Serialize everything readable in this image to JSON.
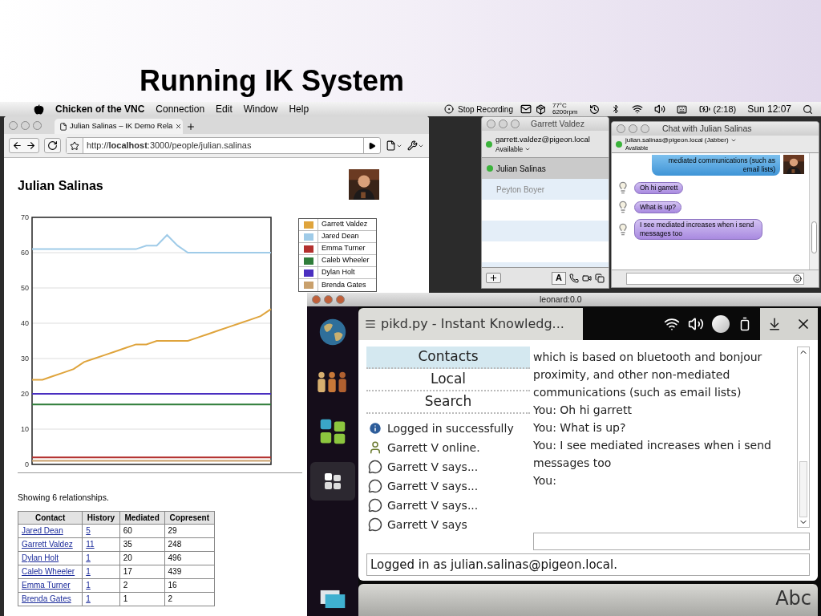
{
  "slide": {
    "title": "Running IK System"
  },
  "menubar": {
    "app": "Chicken of the VNC",
    "menus": [
      "Connection",
      "Edit",
      "Window",
      "Help"
    ],
    "recording": "Stop Recording",
    "temperature": "77°C",
    "fan": "6200rpm",
    "battery": "(2:18)",
    "clock": "Sun 12:07"
  },
  "browser": {
    "tab": {
      "title": "Julian Salinas – IK Demo Rela",
      "selected": true
    },
    "url": "http://**localhost**:3000/people/julian.salinas",
    "page": {
      "heading": "Julian Salinas",
      "chart_data": {
        "type": "line",
        "grid": true,
        "ylim": [
          0,
          70
        ],
        "yticks": [
          0,
          10,
          20,
          30,
          40,
          50,
          60,
          70
        ],
        "series": [
          {
            "name": "Garrett Valdez",
            "color": "#dfa43c",
            "values": [
              24,
              24,
              25,
              26,
              27,
              29,
              30,
              31,
              32,
              33,
              34,
              34,
              35,
              35,
              35,
              35,
              36,
              37,
              38,
              39,
              40,
              41,
              42,
              44
            ]
          },
          {
            "name": "Jared Dean",
            "color": "#9fcbe8",
            "values": [
              61,
              61,
              61,
              61,
              61,
              61,
              61,
              61,
              61,
              61,
              61,
              62,
              62,
              65,
              62,
              60,
              60,
              60,
              60,
              60,
              60,
              60,
              60,
              60
            ]
          },
          {
            "name": "Emma Turner",
            "color": "#b3302e",
            "values": [
              2,
              2,
              2,
              2,
              2,
              2,
              2,
              2,
              2,
              2,
              2,
              2,
              2,
              2,
              2,
              2,
              2,
              2,
              2,
              2,
              2,
              2,
              2,
              2
            ]
          },
          {
            "name": "Caleb Wheeler",
            "color": "#2f7d3a",
            "values": [
              17,
              17,
              17,
              17,
              17,
              17,
              17,
              17,
              17,
              17,
              17,
              17,
              17,
              17,
              17,
              17,
              17,
              17,
              17,
              17,
              17,
              17,
              17,
              17
            ]
          },
          {
            "name": "Dylan Holt",
            "color": "#4a2fc0",
            "values": [
              20,
              20,
              20,
              20,
              20,
              20,
              20,
              20,
              20,
              20,
              20,
              20,
              20,
              20,
              20,
              20,
              20,
              20,
              20,
              20,
              20,
              20,
              20,
              20
            ]
          },
          {
            "name": "Brenda Gates",
            "color": "#c9a06c",
            "values": [
              1,
              1,
              1,
              1,
              1,
              1,
              1,
              1,
              1,
              1,
              1,
              1,
              1,
              1,
              1,
              1,
              1,
              1,
              1,
              1,
              1,
              1,
              1,
              1
            ]
          }
        ]
      },
      "summary": "Showing 6 relationships.",
      "table": {
        "columns": [
          "Contact",
          "History",
          "Mediated",
          "Copresent"
        ],
        "rows": [
          [
            "Jared Dean",
            "5",
            "60",
            "29"
          ],
          [
            "Garrett Valdez",
            "11",
            "35",
            "248"
          ],
          [
            "Dylan Holt",
            "1",
            "20",
            "496"
          ],
          [
            "Caleb Wheeler",
            "1",
            "17",
            "439"
          ],
          [
            "Emma Turner",
            "1",
            "2",
            "16"
          ],
          [
            "Brenda Gates",
            "1",
            "1",
            "2"
          ]
        ]
      }
    }
  },
  "contacts_window": {
    "title": "Garrett Valdez",
    "account": "garrett.valdez@pigeon.local",
    "status": "Available",
    "format_button": "A",
    "contacts": [
      {
        "name": "Julian Salinas",
        "selected": true,
        "online": true
      },
      {
        "name": "Peyton Boyer",
        "selected": false,
        "online": false
      }
    ]
  },
  "chat_window": {
    "title": "Chat with Julian Salinas",
    "account": "julian.salinas@pigeon.local (Jabber)",
    "status": "Available",
    "messages": [
      {
        "kind": "sent",
        "text": "mediated communications (such as email lists)"
      },
      {
        "kind": "received",
        "text": "Oh hi garrett"
      },
      {
        "kind": "received",
        "text": "What is up?"
      },
      {
        "kind": "received",
        "text": "I see mediated increases when i send messages too"
      }
    ]
  },
  "vnc": {
    "title": "leonard:0.0",
    "app_title": "pikd.py - Instant Knowledg...",
    "launcher": [
      {
        "kind": "globe",
        "selected": false
      },
      {
        "kind": "people",
        "selected": false
      },
      {
        "kind": "apps",
        "selected": false
      },
      {
        "kind": "grid",
        "selected": true
      }
    ],
    "tabs": [
      {
        "label": "Contacts",
        "selected": true
      },
      {
        "label": "Local",
        "selected": false
      },
      {
        "label": "Search",
        "selected": false
      }
    ],
    "log": [
      {
        "kind": "info",
        "text": "Logged in successfully"
      },
      {
        "kind": "online",
        "text": "Garrett V online."
      },
      {
        "kind": "message",
        "text": "Garrett V says..."
      },
      {
        "kind": "message",
        "text": "Garrett V says..."
      },
      {
        "kind": "message",
        "text": "Garrett V says..."
      },
      {
        "kind": "message",
        "text": "Garrett V says"
      }
    ],
    "transcript": [
      "which is based on bluetooth and bonjour proximity, and other non-mediated communications (such as email lists)",
      "You: Oh hi garrett",
      "You: What is up?",
      "You: I see mediated increases when i send messages too",
      "You:"
    ],
    "status": "Logged in as julian.salinas@pigeon.local.",
    "keyboard": "Abc"
  }
}
